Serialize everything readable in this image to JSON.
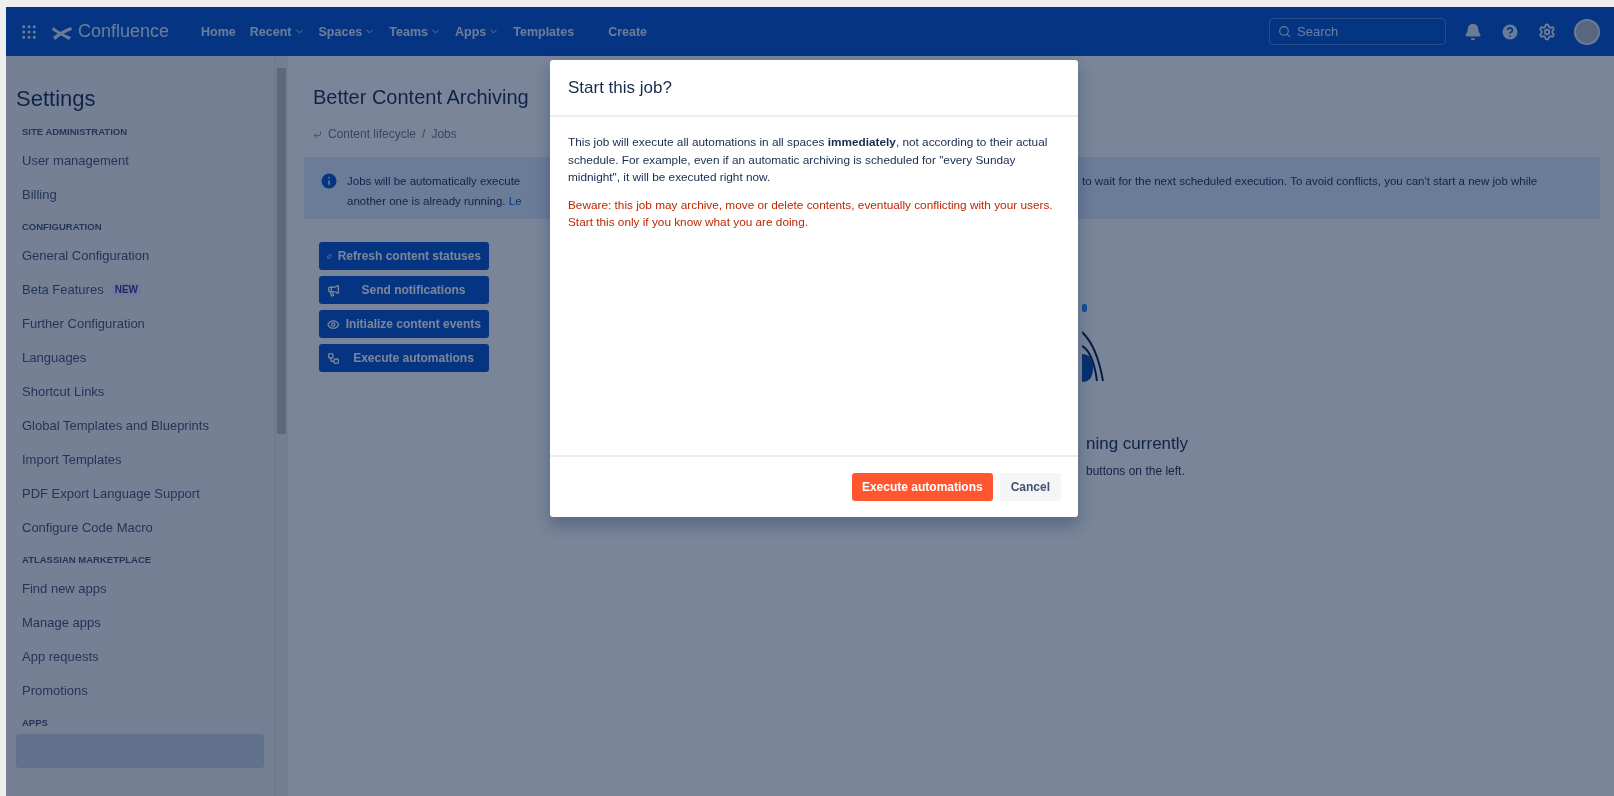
{
  "topbar": {
    "product": "Confluence",
    "nav": [
      {
        "label": "Home",
        "dropdown": false
      },
      {
        "label": "Recent",
        "dropdown": true
      },
      {
        "label": "Spaces",
        "dropdown": true
      },
      {
        "label": "Teams",
        "dropdown": true
      },
      {
        "label": "Apps",
        "dropdown": true
      },
      {
        "label": "Templates",
        "dropdown": false
      },
      {
        "label": "Create",
        "dropdown": false
      }
    ],
    "search": {
      "placeholder": "Search"
    }
  },
  "sidebar": {
    "title": "Settings",
    "sections": [
      {
        "heading": "SITE ADMINISTRATION",
        "items": [
          {
            "label": "User management",
            "selected": false
          },
          {
            "label": "Billing",
            "selected": false
          }
        ]
      },
      {
        "heading": "CONFIGURATION",
        "items": [
          {
            "label": "General Configuration",
            "selected": false
          },
          {
            "label": "Beta Features",
            "badge": "NEW",
            "selected": false
          },
          {
            "label": "Further Configuration",
            "selected": false
          },
          {
            "label": "Languages",
            "selected": false
          },
          {
            "label": "Shortcut Links",
            "selected": false
          },
          {
            "label": "Global Templates and Blueprints",
            "selected": false
          },
          {
            "label": "Import Templates",
            "selected": false
          },
          {
            "label": "PDF Export Language Support",
            "selected": false
          },
          {
            "label": "Configure Code Macro",
            "selected": false
          }
        ]
      },
      {
        "heading": "ATLASSIAN MARKETPLACE",
        "items": [
          {
            "label": "Find new apps",
            "selected": false
          },
          {
            "label": "Manage apps",
            "selected": false
          },
          {
            "label": "App requests",
            "selected": false
          },
          {
            "label": "Promotions",
            "selected": false
          }
        ]
      },
      {
        "heading": "APPS",
        "items": [
          {
            "selected": true
          }
        ]
      }
    ]
  },
  "main": {
    "title": "Better Content Archiving",
    "breadcrumb": {
      "items": [
        "Content lifecycle",
        "Jobs"
      ],
      "separator": "/"
    },
    "info": {
      "left_lines": [
        "Jobs will be automatically execute",
        "another one is already running."
      ],
      "link": "Le",
      "right_line": "to wait for the next scheduled execution. To avoid conflicts, you can't start a new job while"
    },
    "job_buttons": [
      {
        "label": "Refresh content statuses",
        "kind": "refresh"
      },
      {
        "label": "Send notifications",
        "kind": "megaphone"
      },
      {
        "label": "Initialize content events",
        "kind": "eye"
      },
      {
        "label": "Execute automations",
        "kind": "workflow"
      }
    ],
    "empty_state": {
      "heading": "ning currently",
      "text": "buttons on the left."
    }
  },
  "modal": {
    "title": "Start this job?",
    "paragraph": "This job will execute all automations in all spaces **immediately**, not according to their actual schedule. For example, even if an automatic archiving is scheduled for \"every Sunday midnight\", it will be executed right now.",
    "warning": "Beware: this job may archive, move or delete contents, eventually conflicting with your users. Start this only if you know what you are doing.",
    "primary_button": "Execute automations",
    "cancel_button": "Cancel"
  }
}
